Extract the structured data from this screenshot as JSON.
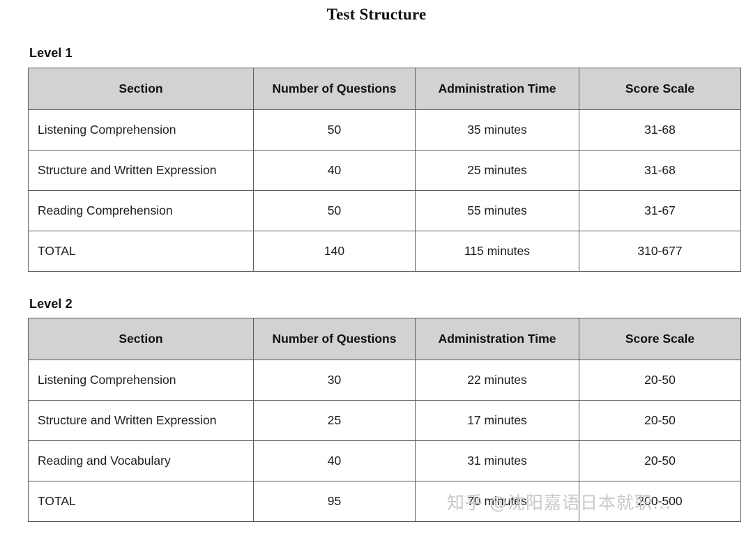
{
  "document": {
    "title": "Test Structure"
  },
  "columns": [
    "Section",
    "Number of Questions",
    "Administration Time",
    "Score Scale"
  ],
  "sections": [
    {
      "label": "Level 1",
      "rows": [
        {
          "section": "Listening Comprehension",
          "questions": "50",
          "time": "35 minutes",
          "score": "31-68"
        },
        {
          "section": "Structure and Written Expression",
          "questions": "40",
          "time": "25 minutes",
          "score": "31-68"
        },
        {
          "section": "Reading Comprehension",
          "questions": "50",
          "time": "55 minutes",
          "score": "31-67"
        },
        {
          "section": "TOTAL",
          "questions": "140",
          "time": "115 minutes",
          "score": "310-677"
        }
      ]
    },
    {
      "label": "Level 2",
      "rows": [
        {
          "section": "Listening Comprehension",
          "questions": "30",
          "time": "22 minutes",
          "score": "20-50"
        },
        {
          "section": "Structure and Written Expression",
          "questions": "25",
          "time": "17 minutes",
          "score": "20-50"
        },
        {
          "section": "Reading and Vocabulary",
          "questions": "40",
          "time": "31 minutes",
          "score": "20-50"
        },
        {
          "section": "TOTAL",
          "questions": "95",
          "time": "70 minutes",
          "score": "200-500"
        }
      ]
    }
  ],
  "watermark": {
    "text": "知乎 @沈阳嘉语日本就职..."
  },
  "colors": {
    "header_background": "#d2d2d2",
    "border": "#5a5a60",
    "text": "#1c1c1c",
    "watermark": "#c8c8c8"
  }
}
